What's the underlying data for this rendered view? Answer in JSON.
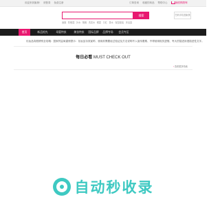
{
  "topbar": {
    "links_left": [
      "欢迎来到聚美!",
      "请登录",
      "免费注册"
    ],
    "links_right": [
      "订单查询",
      "收藏的商品",
      "帮助中心"
    ],
    "cart_label": "我的购物车"
  },
  "search": {
    "placeholder": "",
    "button_label": "搜索",
    "hot_words": [
      "面膜",
      "防晒霜",
      "补水",
      "隔离",
      "洗发水",
      "眼霜",
      "口红",
      "香水",
      "保湿套装",
      "沐浴露"
    ]
  },
  "qr_label": "扫码手机逛聚美",
  "nav": {
    "items": [
      "首页",
      "新品抢先",
      "母婴特卖",
      "美妆特卖",
      "国际品牌",
      "品牌专场",
      "会员专区"
    ],
    "active_index": 0
  },
  "notice": "化妆品真假辨别全攻略：国家药监局重磅提示：化妆品功效宣称、使用前需要经过验证及方法说明不入宣传要素、不得使用相关虚假、夸大的描述用语描述性文字。",
  "section": {
    "title_cn": "每日必看",
    "title_en": "MUST CHECK OUT",
    "view_all": "查看更多特卖"
  },
  "watermark": {
    "text": "自动秒收录"
  },
  "colors": {
    "accent": "#e8176f",
    "nav_bg": "#1c1c1c",
    "watermark": "#3ec9c2"
  }
}
